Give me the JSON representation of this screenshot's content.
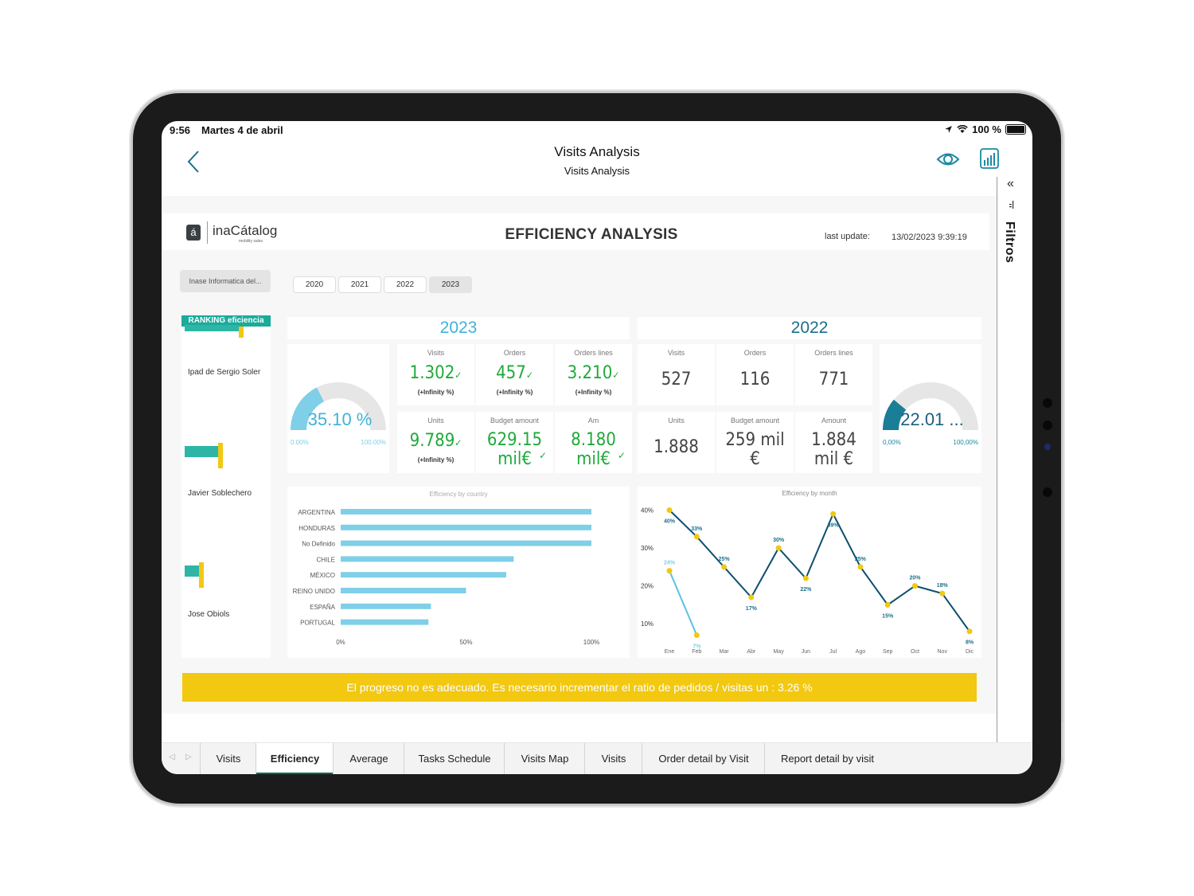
{
  "statusbar": {
    "time": "9:56",
    "date": "Martes 4 de abril",
    "battery": "100 %"
  },
  "navbar": {
    "title": "Visits Analysis",
    "subtitle": "Visits Analysis"
  },
  "filters_pane": {
    "label": "Filtros",
    "collapse_glyph": "«"
  },
  "report": {
    "logo_glyph": "á",
    "logo_text": "inaCátalog",
    "logo_tagline": "mobility sales",
    "title": "EFFICIENCY ANALYSIS",
    "last_update_label": "last update:",
    "last_update_value": "13/02/2023 9:39:19",
    "company_slicer": "Inase Informatica del...",
    "years": [
      {
        "label": "2020",
        "selected": false
      },
      {
        "label": "2021",
        "selected": false
      },
      {
        "label": "2022",
        "selected": false
      },
      {
        "label": "2023",
        "selected": true
      }
    ],
    "colors": {
      "accent_teal": "#1aab9b",
      "accent_yellow": "#f2c811",
      "kpi_green": "#1faa3a",
      "light_blue": "#7fcfe8",
      "dark_blue": "#1a6f8c",
      "navy_line": "#0d4f6e"
    }
  },
  "ranking": {
    "title": "RANKING eficiencia",
    "items": [
      {
        "name": "Ipad de Sergio Soler",
        "value": 0.62,
        "target": 0.62
      },
      {
        "name": "Javier Soblechero",
        "value": 0.38,
        "target": 0.38
      },
      {
        "name": "Jose Obiols",
        "value": 0.16,
        "target": 0.16
      }
    ]
  },
  "current_year": {
    "year": "2023",
    "gauge": {
      "value_label": "35.10 %",
      "fraction": 0.351,
      "min_label": "0.00%",
      "max_label": "100.00%"
    },
    "kpis": [
      {
        "label": "Visits",
        "value": "1.302",
        "check": "✓",
        "sub": "(+Infinity %)"
      },
      {
        "label": "Orders",
        "value": "457",
        "check": "✓",
        "sub": "(+Infinity %)"
      },
      {
        "label": "Orders lines",
        "value": "3.210",
        "check": "✓",
        "sub": "(+Infinity %)"
      },
      {
        "label": "Units",
        "value": "9.789",
        "check": "✓",
        "sub": "(+Infinity %)"
      },
      {
        "label": "Budget amount",
        "value": "629.15",
        "value2": "mil€",
        "check": "✓",
        "sub": ""
      },
      {
        "label": "Am",
        "value": "8.180",
        "value2": "mil€",
        "check": "✓",
        "sub": ""
      }
    ]
  },
  "previous_year": {
    "year": "2022",
    "gauge": {
      "value_label": "22.01 ...",
      "fraction": 0.2201,
      "min_label": "0,00%",
      "max_label": "100,00%"
    },
    "kpis": [
      {
        "label": "Visits",
        "value": "527"
      },
      {
        "label": "Orders",
        "value": "116"
      },
      {
        "label": "Orders lines",
        "value": "771"
      },
      {
        "label": "Units",
        "value": "1.888"
      },
      {
        "label": "Budget amount",
        "value": "259 mil",
        "value2": "€"
      },
      {
        "label": "Amount",
        "value": "1.884",
        "value2": "mil €"
      }
    ]
  },
  "chart_data": [
    {
      "type": "bar",
      "orientation": "horizontal",
      "title": "Efficiency by country",
      "categories": [
        "ARGENTINA",
        "HONDURAS",
        "No Definido",
        "CHILE",
        "MÉXICO",
        "REINO UNIDO",
        "ESPAÑA",
        "PORTUGAL"
      ],
      "values": [
        100,
        100,
        100,
        69,
        66,
        50,
        36,
        35
      ],
      "xlim": [
        0,
        100
      ],
      "xticks": [
        "0%",
        "50%",
        "100%"
      ],
      "xlabel": "",
      "ylabel": "",
      "grid": false,
      "color": "#7fcfe8"
    },
    {
      "type": "line",
      "title": "Efficiency by month",
      "x": [
        "Ene",
        "Feb",
        "Mar",
        "Abr",
        "May",
        "Jun",
        "Jul",
        "Ago",
        "Sep",
        "Oct",
        "Nov",
        "Dic"
      ],
      "ylim": [
        5,
        42
      ],
      "yticks": [
        "10%",
        "20%",
        "30%",
        "40%"
      ],
      "ytick_values": [
        10,
        20,
        30,
        40
      ],
      "grid": false,
      "series": [
        {
          "name": "2022",
          "color": "#0d4f6e",
          "label_color": "#1a6f8c",
          "values": [
            40,
            33,
            25,
            17,
            30,
            22,
            39,
            25,
            15,
            20,
            18,
            8
          ],
          "labels": [
            "40%",
            "33%",
            "25%",
            "17%",
            "30%",
            "22%",
            "39%",
            "25%",
            "15%",
            "20%",
            "18%",
            "8%"
          ]
        },
        {
          "name": "2023",
          "color": "#5bc0e3",
          "label_color": "#7fcfe8",
          "values": [
            24,
            7,
            null,
            null,
            null,
            null,
            null,
            null,
            null,
            null,
            null,
            null
          ],
          "labels": [
            "24%",
            "7%",
            "",
            "",
            "",
            "",
            "",
            "",
            "",
            "",
            "",
            ""
          ]
        }
      ],
      "marker_color": "#f2c811"
    }
  ],
  "warning": {
    "text": "El progreso no es adecuado. Es necesario incrementar el ratio de pedidos / visitas un : 3.26 %"
  },
  "tabs": [
    {
      "label": "Visits",
      "active": false
    },
    {
      "label": "Efficiency",
      "active": true
    },
    {
      "label": "Average",
      "active": false
    },
    {
      "label": "Tasks Schedule",
      "active": false
    },
    {
      "label": "Visits Map",
      "active": false
    },
    {
      "label": "Visits",
      "active": false
    },
    {
      "label": "Order detail by Visit",
      "active": false
    },
    {
      "label": "Report detail by visit",
      "active": false
    }
  ],
  "tab_arrows": {
    "prev": "◁",
    "next": "▷"
  }
}
